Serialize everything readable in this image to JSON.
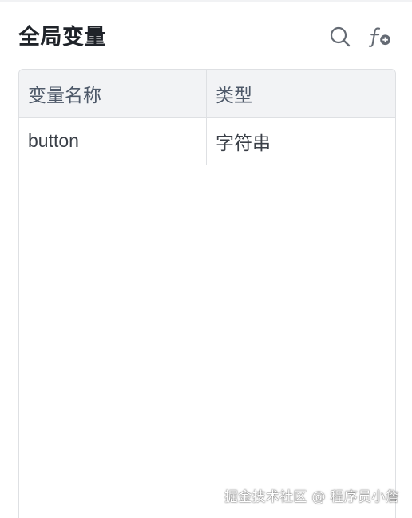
{
  "panel": {
    "title": "全局变量",
    "search_icon": "search-icon",
    "add_function_icon": "function-add-icon"
  },
  "table": {
    "columns": [
      "变量名称",
      "类型"
    ],
    "rows": [
      {
        "name": "button",
        "type": "字符串"
      }
    ]
  },
  "watermark": "掘金技术社区 @ 程序员小詹",
  "colors": {
    "title": "#1f2329",
    "header_bg": "#f2f3f5",
    "border": "#dee0e3",
    "icon": "#646a73"
  }
}
